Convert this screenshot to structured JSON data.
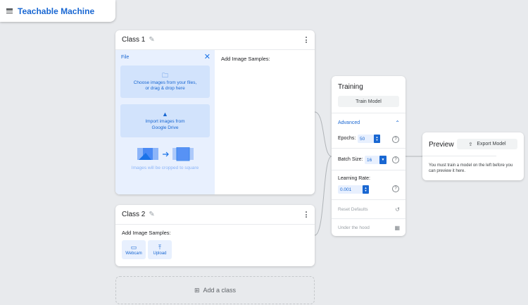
{
  "app": {
    "title": "Teachable Machine"
  },
  "classes": [
    {
      "name": "Class 1",
      "upload_panel": {
        "title": "File",
        "choose_files_text": "Choose images from your files, or drag & drop here",
        "drive_text": "Import images from Google Drive",
        "crop_note": "Images will be cropped to square"
      },
      "samples_label": "Add Image Samples:"
    },
    {
      "name": "Class 2",
      "samples_label": "Add Image Samples:",
      "buttons": [
        {
          "label": "Webcam",
          "icon": "video-camera-icon"
        },
        {
          "label": "Upload",
          "icon": "upload-icon"
        }
      ]
    }
  ],
  "add_class": {
    "label": "Add a class",
    "icon": "add-box-icon"
  },
  "training": {
    "title": "Training",
    "train_button": "Train Model",
    "advanced_label": "Advanced",
    "epochs": {
      "label": "Epochs:",
      "value": "50"
    },
    "batch_size": {
      "label": "Batch Size:",
      "value": "16"
    },
    "learning_rate": {
      "label": "Learning Rate:",
      "value": "0.001"
    },
    "reset_defaults": "Reset Defaults",
    "under_the_hood": "Under the hood"
  },
  "preview": {
    "title": "Preview",
    "export_button": "Export Model",
    "note": "You must train a model on the left before you can preview it here."
  },
  "colors": {
    "accent": "#1967d2",
    "panel_blue": "#e8f0fe",
    "background": "#e8eaed"
  }
}
